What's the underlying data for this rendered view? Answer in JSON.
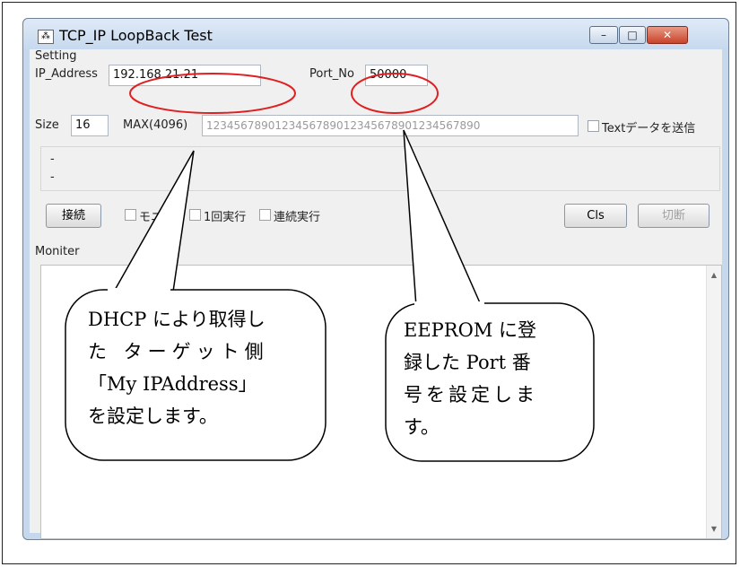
{
  "window": {
    "title": "TCP_IP LoopBack Test",
    "buttons": {
      "minimize": "–",
      "maximize": "□",
      "close": "✕"
    },
    "icons": {
      "app": "network-icon"
    }
  },
  "setting": {
    "group_label": "Setting",
    "ip_label": "IP_Address",
    "ip_value": "192.168.21.21",
    "port_label": "Port_No",
    "port_value": "50000"
  },
  "size_row": {
    "size_label": "Size",
    "size_value": "16",
    "max_label": "MAX(4096)",
    "data_value": "1234567890123456789012345678901234567890",
    "text_checkbox_label": "Textデータを送信"
  },
  "status": {
    "line1": "-",
    "line2": "-"
  },
  "controls": {
    "connect": "接続",
    "monitor_check": "モニタ",
    "once_check": "1回実行",
    "continuous_check": "連続実行",
    "cls": "Cls",
    "disconnect": "切断"
  },
  "monitor": {
    "label": "Moniter"
  },
  "annotations": {
    "left_callout": [
      "DHCP により取得し",
      "た ターゲット側",
      "「My IPAddress」",
      "を設定します。"
    ],
    "right_callout": [
      "EEPROM に登",
      "録した Port 番",
      "号を設定しま",
      "す。"
    ]
  },
  "colors": {
    "highlight": "#e02020",
    "window_border": "#c5d8ec"
  }
}
